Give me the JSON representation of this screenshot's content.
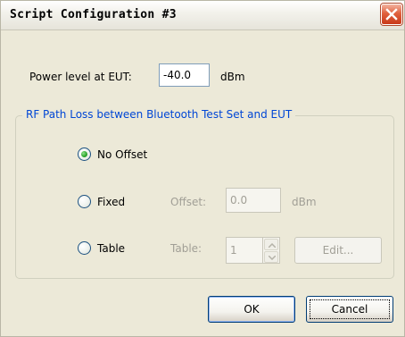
{
  "window": {
    "title": "Script Configuration #3"
  },
  "power": {
    "label": "Power level at EUT:",
    "value": "-40.0",
    "unit": "dBm"
  },
  "group": {
    "title": "RF Path Loss between Bluetooth Test Set and EUT",
    "options": [
      {
        "label": "No Offset",
        "selected": true
      },
      {
        "label": "Fixed",
        "selected": false
      },
      {
        "label": "Table",
        "selected": false
      }
    ],
    "offset": {
      "label": "Offset:",
      "value": "0.0",
      "unit": "dBm"
    },
    "table": {
      "label": "Table:",
      "value": "1",
      "edit_label": "Edit..."
    }
  },
  "buttons": {
    "ok": "OK",
    "cancel": "Cancel"
  },
  "colors": {
    "group_title": "#0046d5",
    "dialog_bg": "#ece9d8",
    "close": "#e0613e"
  }
}
